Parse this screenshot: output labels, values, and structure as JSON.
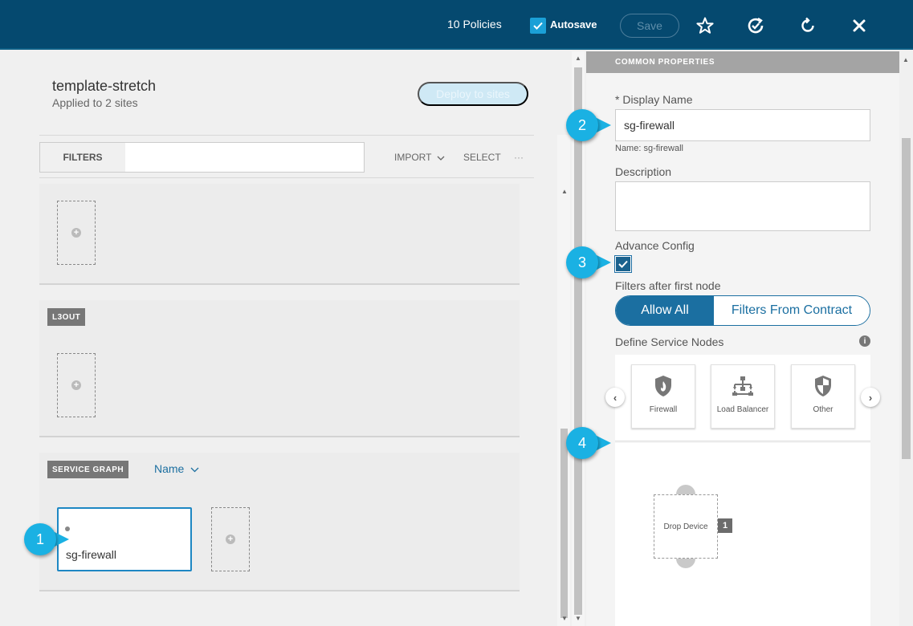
{
  "topbar": {
    "policies": "10 Policies",
    "autosave_label": "Autosave",
    "autosave_checked": true,
    "save_label": "Save",
    "icons": [
      "star-icon",
      "refresh-check-icon",
      "reload-icon",
      "close-icon"
    ]
  },
  "template": {
    "name": "template-stretch",
    "applied": "Applied to 2 sites",
    "deploy_label": "Deploy to sites"
  },
  "filter_bar": {
    "label": "FILTERS",
    "value": "",
    "import_label": "IMPORT",
    "select_label": "SELECT",
    "more_label": "···"
  },
  "cards": {
    "l3out_tag": "L3OUT",
    "service_graph_tag": "SERVICE GRAPH",
    "sort_label": "Name",
    "graph_node_label": "sg-firewall"
  },
  "properties": {
    "header": "COMMON PROPERTIES",
    "display_name_label": "* Display Name",
    "display_name_value": "sg-firewall",
    "name_hint": "Name: sg-firewall",
    "description_label": "Description",
    "description_value": "",
    "advance_config_label": "Advance Config",
    "advance_config_checked": true,
    "filters_label": "Filters after first node",
    "filter_options": [
      "Allow All",
      "Filters From Contract"
    ],
    "filter_selected": "Allow All",
    "service_nodes_label": "Define Service Nodes",
    "service_nodes": [
      {
        "label": "Firewall",
        "icon": "firewall-icon"
      },
      {
        "label": "Load Balancer",
        "icon": "load-balancer-icon"
      },
      {
        "label": "Other",
        "icon": "shield-icon"
      }
    ],
    "drop_device_label": "Drop Device",
    "drop_device_badge": "1"
  },
  "callouts": [
    "1",
    "2",
    "3",
    "4"
  ],
  "colors": {
    "topbar": "#05496f",
    "accent": "#1b6fa1",
    "callout": "#1ab1e3"
  }
}
